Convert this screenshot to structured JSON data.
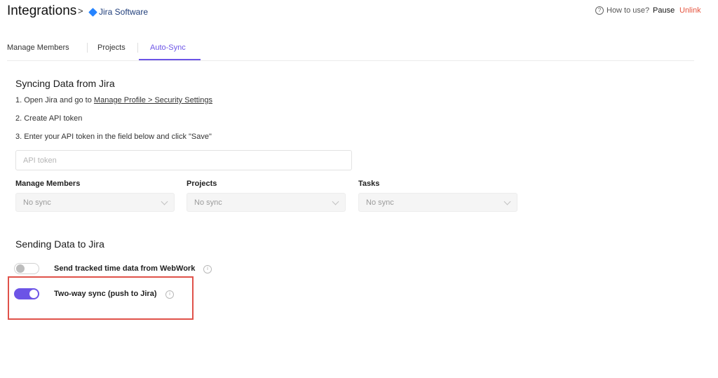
{
  "header": {
    "title": "Integrations",
    "separator": ">",
    "integration": "Jira Software",
    "how_to_use": "How to use?",
    "pause": "Pause",
    "unlink": "Unlink"
  },
  "tabs": [
    {
      "label": "Manage Members"
    },
    {
      "label": "Projects"
    },
    {
      "label": "Auto-Sync",
      "active": true
    }
  ],
  "syncing": {
    "heading": "Syncing Data from Jira",
    "step1_prefix": "1. Open Jira and go to ",
    "step1_link": "Manage Profile > Security Settings",
    "step2": "2. Create API token",
    "step3": "3. Enter your API token in the field below and click \"Save\"",
    "api_placeholder": "API token",
    "api_value": "",
    "selects": [
      {
        "label": "Manage Members",
        "value": "No sync"
      },
      {
        "label": "Projects",
        "value": "No sync"
      },
      {
        "label": "Tasks",
        "value": "No sync"
      }
    ]
  },
  "sending": {
    "heading": "Sending Data to Jira",
    "toggles": [
      {
        "label": "Send tracked time data from WebWork",
        "enabled": false
      },
      {
        "label": "Two-way sync (push to Jira)",
        "enabled": true
      }
    ]
  },
  "colors": {
    "accent": "#6c54e6",
    "unlink": "#e5533d",
    "highlight": "#e0524a",
    "jira_blue": "#2684ff"
  }
}
